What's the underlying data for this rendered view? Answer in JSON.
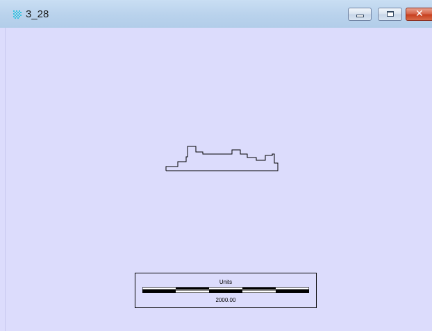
{
  "window": {
    "title": "3_28",
    "icon": "grid-app-icon",
    "buttons": {
      "minimize_icon": "minimize-icon",
      "maximize_icon": "maximize-icon",
      "close_icon": "close-icon",
      "close_glyph": "✕"
    }
  },
  "colors": {
    "canvas_background": "#dcdcfc",
    "title_bar": "#b9d2ec",
    "close_button": "#c7401f",
    "drawing_line": "#000000",
    "app_icon": "#35c2e0"
  },
  "scale_bar": {
    "units_label": "Units",
    "value_label": "2000.00"
  }
}
